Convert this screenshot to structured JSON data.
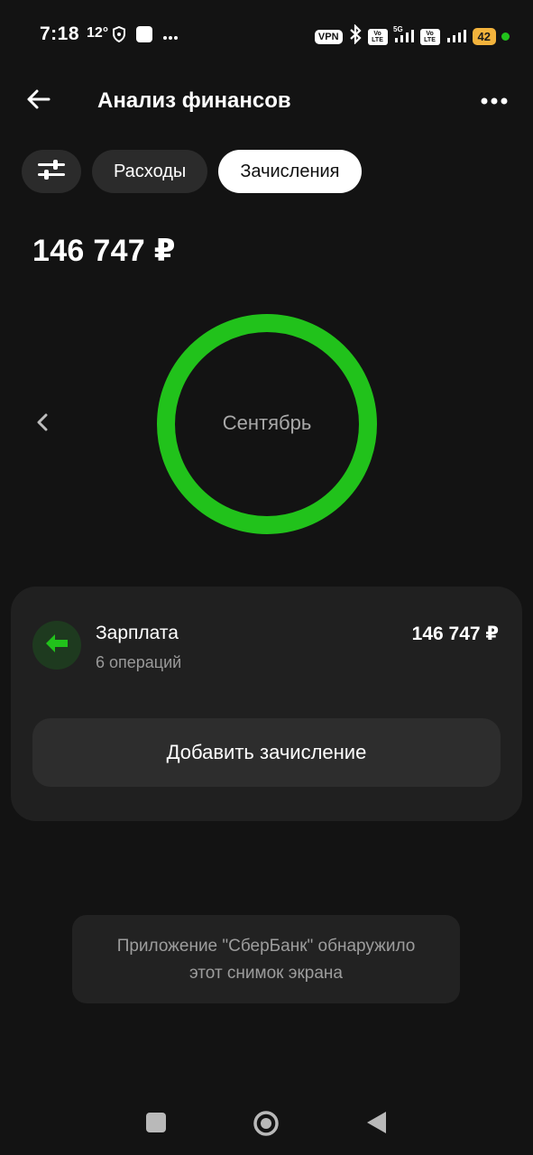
{
  "status_bar": {
    "time": "7:18",
    "temperature": "12°",
    "vpn": "VPN",
    "network": "5G",
    "volte": "Vo LTE",
    "battery": "42",
    "icons": [
      "shield-icon",
      "square-notification-icon",
      "more-dots-icon",
      "bluetooth-icon",
      "signal-icon",
      "battery-icon"
    ]
  },
  "header": {
    "title": "Анализ финансов",
    "back_icon": "arrow-left-icon",
    "more_icon": "more-horizontal-icon"
  },
  "tabs": {
    "filter_icon": "sliders-icon",
    "expenses": "Расходы",
    "income": "Зачисления",
    "active": "Зачисления"
  },
  "summary": {
    "total": "146 747 ₽"
  },
  "chart": {
    "period_label": "Сентябрь",
    "prev_icon": "chevron-left-icon",
    "ring_color": "#21c21b"
  },
  "chart_data": {
    "type": "pie",
    "categories": [
      "Зарплата"
    ],
    "values": [
      146747
    ],
    "colors": [
      "#21c21b"
    ],
    "title": "Сентябрь"
  },
  "income_list": [
    {
      "title": "Зарплата",
      "subtitle": "6 операций",
      "amount": "146 747 ₽",
      "icon": "arrow-left-icon",
      "icon_color": "#21c21b"
    }
  ],
  "add_button": "Добавить зачисление",
  "toast": {
    "line1": "Приложение \"СберБанк\" обнаружило",
    "line2": "этот снимок экрана"
  },
  "nav": {
    "icons": [
      "recents-icon",
      "home-icon",
      "back-triangle-icon"
    ]
  },
  "colors": {
    "accent": "#21c21b",
    "background": "#131313",
    "card": "#202020"
  }
}
